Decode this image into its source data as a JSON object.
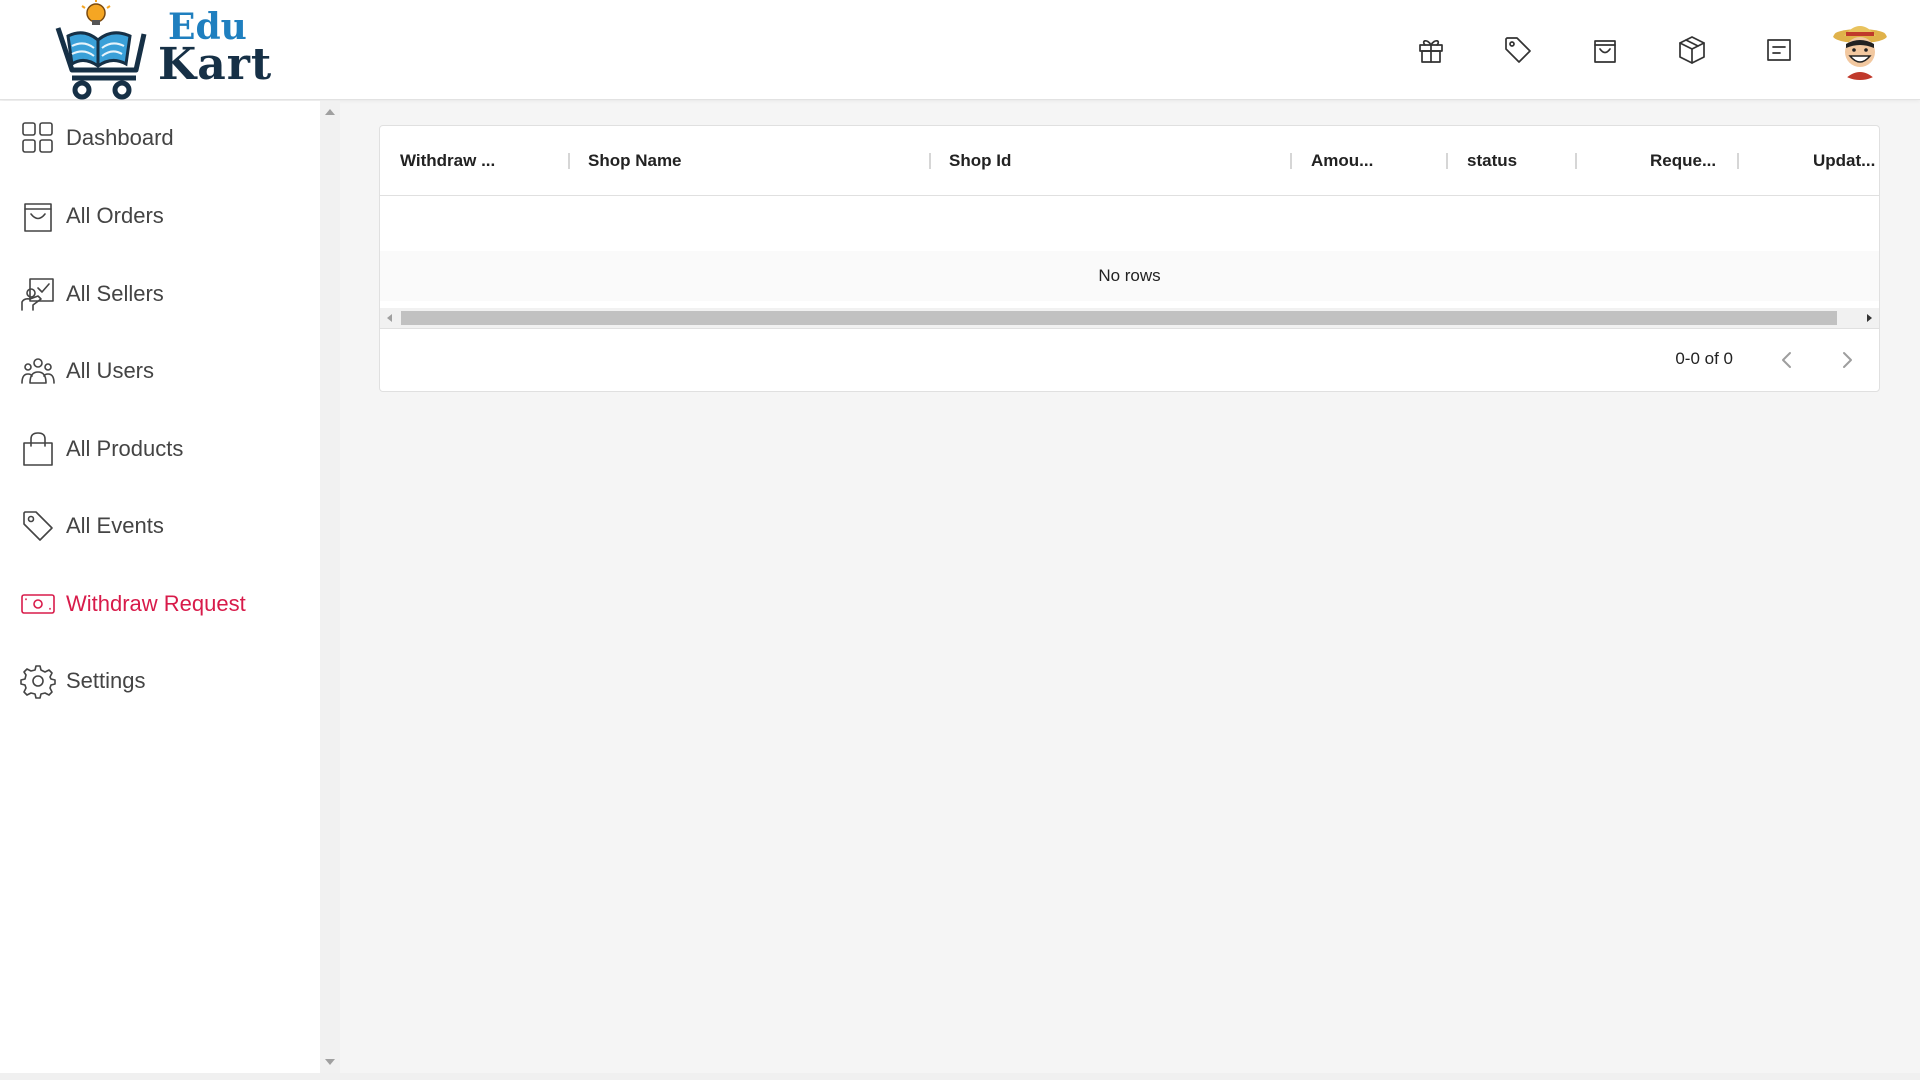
{
  "app": {
    "logo_line1": "Edu",
    "logo_line2": "Kart"
  },
  "header": {
    "icons": [
      "gift-icon",
      "tag-icon",
      "shopping-bag-icon",
      "package-icon",
      "message-icon"
    ],
    "avatar": "user-avatar"
  },
  "sidebar": {
    "items": [
      {
        "label": "Dashboard",
        "icon": "dashboard-grid-icon"
      },
      {
        "label": "All Orders",
        "icon": "shopping-bag-icon"
      },
      {
        "label": "All Sellers",
        "icon": "sellers-icon"
      },
      {
        "label": "All Users",
        "icon": "users-icon"
      },
      {
        "label": "All Products",
        "icon": "bag-icon"
      },
      {
        "label": "All Events",
        "icon": "tag-icon"
      },
      {
        "label": "Withdraw Request",
        "icon": "money-icon",
        "active": true
      },
      {
        "label": "Settings",
        "icon": "gear-icon"
      }
    ],
    "active_color": "#d81b4a"
  },
  "grid": {
    "columns": [
      "Withdraw ...",
      "Shop Name",
      "Shop Id",
      "Amou...",
      "status",
      "Reque...",
      "Updat..."
    ],
    "empty_text": "No rows",
    "pagination": "0-0 of 0"
  }
}
